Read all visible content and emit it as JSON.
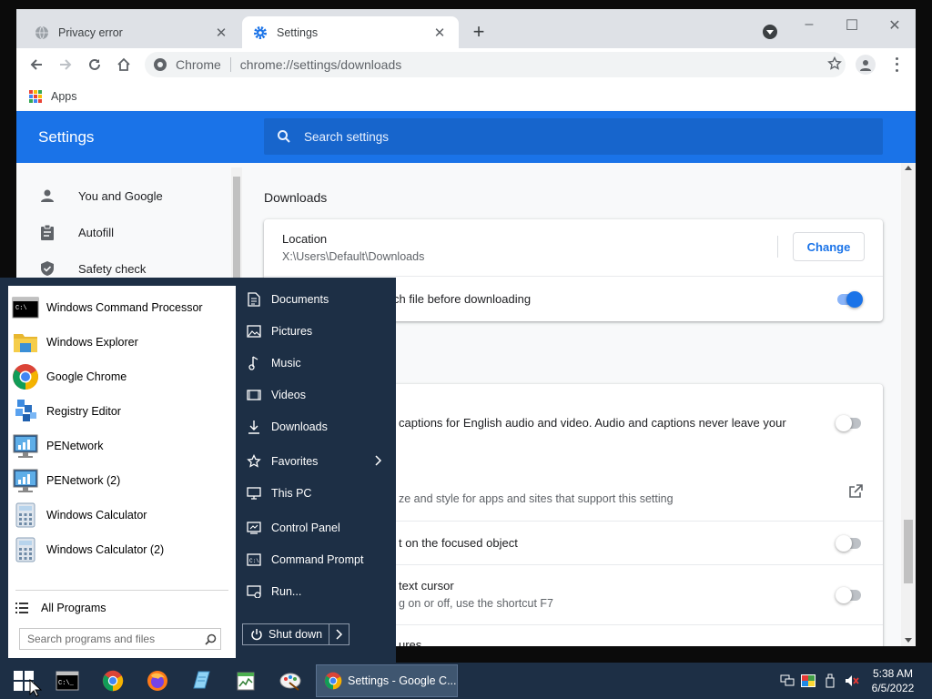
{
  "browser": {
    "tabs": [
      {
        "title": "Privacy error"
      },
      {
        "title": "Settings"
      }
    ],
    "omnibox": {
      "origin": "Chrome",
      "url": "chrome://settings/downloads"
    },
    "bookmarks": {
      "apps_label": "Apps"
    }
  },
  "settings": {
    "header_title": "Settings",
    "search_placeholder": "Search settings",
    "nav": [
      {
        "label": "You and Google",
        "icon": "person-icon"
      },
      {
        "label": "Autofill",
        "icon": "clipboard-icon"
      },
      {
        "label": "Safety check",
        "icon": "shield-icon"
      }
    ],
    "downloads": {
      "section_title": "Downloads",
      "location_label": "Location",
      "location_value": "X:\\Users\\Default\\Downloads",
      "change_label": "Change",
      "ask_label": "ch file before downloading",
      "ask_enabled": true
    },
    "accessibility": {
      "captions_text": "captions for English audio and video. Audio and captions never leave your",
      "captions_enabled": false,
      "font_size_text": "ze and style for apps and sites that support this setting",
      "focus_text": "t on the focused object",
      "focus_enabled": false,
      "caret_title": "text cursor",
      "caret_sub": "g on or off, use the shortcut F7",
      "caret_enabled": false,
      "bottom_partial": "ures"
    }
  },
  "start_menu": {
    "programs": [
      {
        "label": "Windows Command Processor",
        "icon": "cmd-icon"
      },
      {
        "label": "Windows Explorer",
        "icon": "explorer-icon"
      },
      {
        "label": "Google Chrome",
        "icon": "chrome-icon"
      },
      {
        "label": "Registry Editor",
        "icon": "registry-icon"
      },
      {
        "label": "PENetwork",
        "icon": "network-icon"
      },
      {
        "label": "PENetwork (2)",
        "icon": "network-icon"
      },
      {
        "label": "Windows Calculator",
        "icon": "calculator-icon"
      },
      {
        "label": "Windows Calculator (2)",
        "icon": "calculator-icon"
      }
    ],
    "all_programs_label": "All Programs",
    "search_placeholder": "Search programs and files",
    "places": [
      {
        "label": "Documents",
        "icon": "document-icon"
      },
      {
        "label": "Pictures",
        "icon": "picture-icon"
      },
      {
        "label": "Music",
        "icon": "music-icon"
      },
      {
        "label": "Videos",
        "icon": "video-icon"
      },
      {
        "label": "Downloads",
        "icon": "download-icon"
      },
      {
        "label": "Favorites",
        "icon": "star-icon"
      },
      {
        "label": "This PC",
        "icon": "computer-icon"
      },
      {
        "label": "Control Panel",
        "icon": "control-panel-icon"
      },
      {
        "label": "Command Prompt",
        "icon": "cmd-icon"
      },
      {
        "label": "Run...",
        "icon": "run-icon"
      }
    ],
    "shutdown_label": "Shut down"
  },
  "taskbar": {
    "active_task": "Settings - Google C...",
    "time": "5:38 AM",
    "date": "6/5/2022"
  },
  "colors": {
    "chrome_blue": "#1a73e8",
    "startmenu_bg": "#1d2f45",
    "taskbar_bg": "#1d2f45"
  }
}
